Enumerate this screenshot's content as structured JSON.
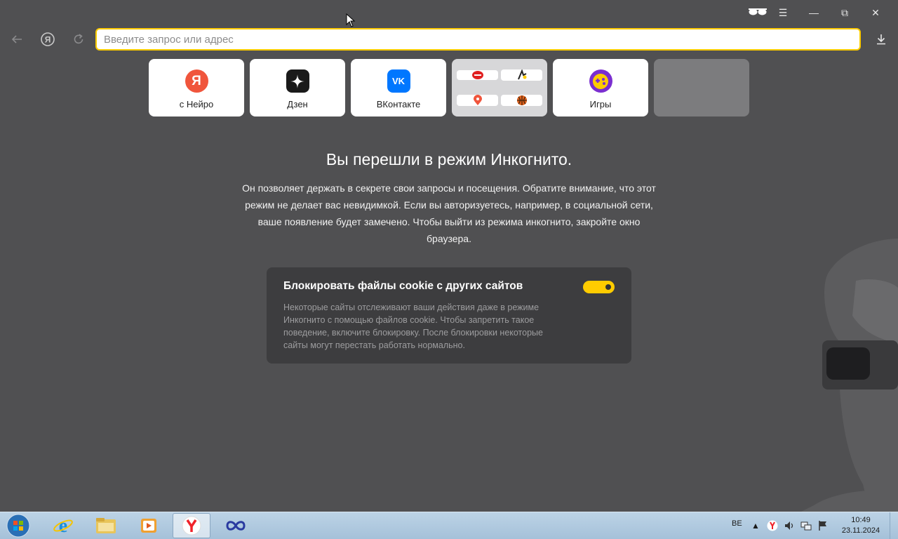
{
  "browser": {
    "address_placeholder": "Введите запрос или адрес",
    "controls": {
      "incognito": "glasses-icon",
      "menu": "☰",
      "minimize": "—",
      "restore": "⧉",
      "close": "✕"
    }
  },
  "tiles": [
    {
      "label": "с Нейро",
      "icon": "yandex-icon",
      "color": "#f0553c"
    },
    {
      "label": "Дзен",
      "icon": "dzen-icon",
      "color": "#1a1a1a"
    },
    {
      "label": "ВКонтакте",
      "icon": "vk-icon",
      "color": "#0077ff"
    },
    {
      "label": "Игры",
      "icon": "games-icon",
      "color": "#7b2fd0"
    }
  ],
  "incognito": {
    "title": "Вы перешли в режим Инкогнито.",
    "description": "Он позволяет держать в секрете свои запросы и посещения. Обратите внимание, что этот режим не делает вас невидимкой. Если вы авторизуетесь, например, в социальной сети, ваше появление будет замечено. Чтобы выйти из режима инкогнито, закройте окно браузера."
  },
  "cookie_card": {
    "title": "Блокировать файлы cookie с других сайтов",
    "description": "Некоторые сайты отслеживают ваши действия даже в режиме Инкогнито с помощью файлов cookie. Чтобы запретить такое поведение, включите блокировку. После блокировки некоторые сайты могут перестать работать нормально.",
    "toggle_on": true
  },
  "taskbar": {
    "language": "BE",
    "time": "10:49",
    "date": "23.11.2024"
  },
  "colors": {
    "accent": "#ffcc00",
    "background": "#505052",
    "card": "#3d3d3f"
  }
}
